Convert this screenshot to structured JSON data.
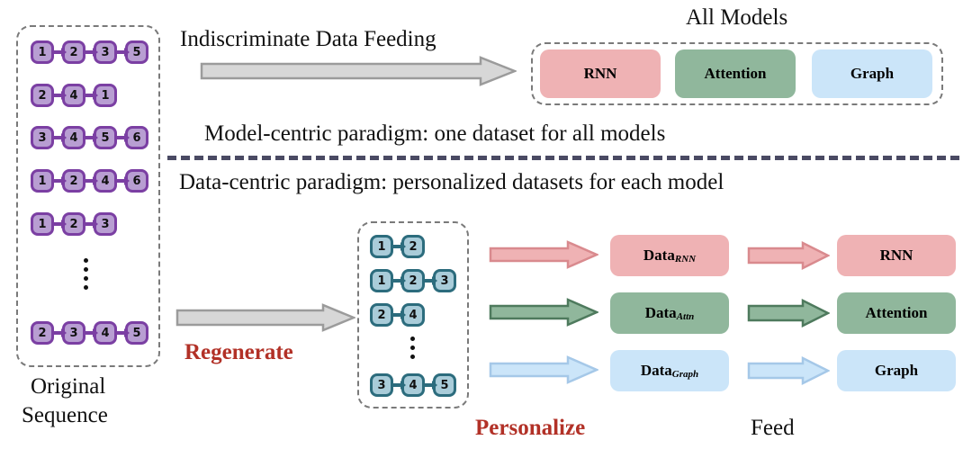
{
  "left_panel": {
    "name": "original-sequence-panel",
    "caption_line1": "Original",
    "caption_line2": "Sequence",
    "sequences": [
      [
        "1",
        "2",
        "3",
        "5"
      ],
      [
        "2",
        "4",
        "1"
      ],
      [
        "3",
        "4",
        "5",
        "6"
      ],
      [
        "1",
        "2",
        "4",
        "6"
      ],
      [
        "1",
        "2",
        "3"
      ],
      [
        "2",
        "3",
        "4",
        "5"
      ]
    ],
    "ellipsis": "vertical-dots",
    "node_fill": "#b89ed2",
    "node_border": "#7b3fa3"
  },
  "top_flow": {
    "arrow_label": "Indiscriminate Data Feeding",
    "arrow_color": "#d4d4d4",
    "arrow_border": "#9a9a9a",
    "all_models_title": "All Models",
    "models": [
      {
        "label": "RNN",
        "color": "#efb2b4"
      },
      {
        "label": "Attention",
        "color": "#90b79c"
      },
      {
        "label": "Graph",
        "color": "#cbe5f9"
      }
    ]
  },
  "paradigms": {
    "model_centric": "Model-centric paradigm: one dataset for all models",
    "data_centric": "Data-centric paradigm: personalized datasets for each model",
    "divider_color": "#4a4a63"
  },
  "bottom_flow": {
    "regenerate_label": "Regenerate",
    "personalize_label": "Personalize",
    "feed_label": "Feed",
    "accent_red": "#b23127",
    "regenerated_panel": {
      "name": "regenerated-sequence-panel",
      "sequences": [
        [
          "1",
          "2"
        ],
        [
          "1",
          "2",
          "3"
        ],
        [
          "2",
          "4"
        ],
        [
          "3",
          "4",
          "5"
        ]
      ],
      "ellipsis": "vertical-dots",
      "node_fill": "#a9ccd9",
      "node_border": "#2c6c7d"
    },
    "rows": [
      {
        "dataset_label": "Data",
        "dataset_sub": "RNN",
        "model_label": "RNN",
        "fill": "#efb2b4",
        "stroke": "#d98a8e"
      },
      {
        "dataset_label": "Data",
        "dataset_sub": "Attn",
        "model_label": "Attention",
        "fill": "#90b79c",
        "stroke": "#4e7a5d"
      },
      {
        "dataset_label": "Data",
        "dataset_sub": "Graph",
        "model_label": "Graph",
        "fill": "#cbe5f9",
        "stroke": "#a5c8e8"
      }
    ]
  }
}
